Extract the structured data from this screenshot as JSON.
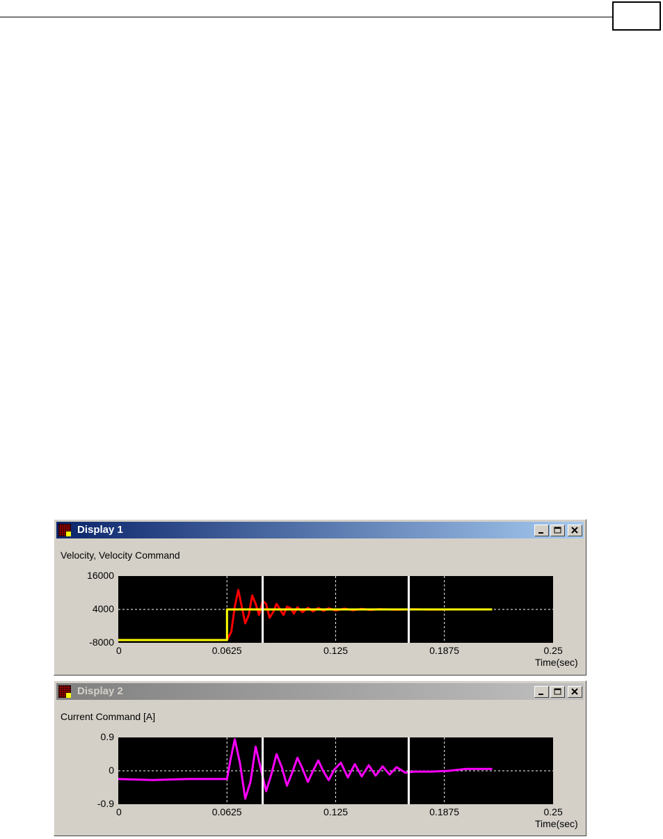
{
  "displays": [
    {
      "title": "Display 1",
      "active": true,
      "chart_data": {
        "type": "line",
        "title": "Velocity, Velocity Command",
        "xlabel": "Time(sec)",
        "x_ticks": [
          "0",
          "0.0625",
          "0.125",
          "0.1875",
          "0.25"
        ],
        "y_ticks": [
          "16000",
          "4000",
          "-8000"
        ],
        "xlim": [
          0,
          0.25
        ],
        "ylim": [
          -8000,
          16000
        ],
        "grid": true,
        "cursors_x": [
          0.083,
          0.167
        ],
        "series": [
          {
            "color": "#ff0000",
            "x": [
              0,
              0.062,
              0.0625,
              0.065,
              0.067,
              0.069,
              0.071,
              0.073,
              0.075,
              0.077,
              0.079,
              0.081,
              0.083,
              0.085,
              0.087,
              0.089,
              0.091,
              0.093,
              0.095,
              0.097,
              0.099,
              0.101,
              0.103,
              0.106,
              0.109,
              0.112,
              0.115,
              0.118,
              0.121,
              0.125,
              0.13,
              0.135,
              0.14,
              0.145,
              0.15,
              0.16,
              0.17,
              0.18,
              0.19,
              0.2,
              0.215
            ],
            "y": [
              -7000,
              -7000,
              -7000,
              -4000,
              5000,
              11000,
              5000,
              -1000,
              2000,
              9000,
              6000,
              2000,
              7000,
              6000,
              1000,
              3000,
              6000,
              4000,
              2000,
              5000,
              4500,
              2500,
              4800,
              3000,
              4600,
              3300,
              4500,
              3500,
              4400,
              3600,
              4300,
              3700,
              4200,
              3800,
              4100,
              3900,
              4050,
              3950,
              4000,
              4000,
              4000
            ]
          },
          {
            "color": "#ffff00",
            "x": [
              0,
              0.0625,
              0.0625,
              0.215
            ],
            "y": [
              -7000,
              -7000,
              4000,
              4000
            ]
          }
        ]
      }
    },
    {
      "title": "Display 2",
      "active": false,
      "chart_data": {
        "type": "line",
        "title": "Current Command [A]",
        "xlabel": "Time(sec)",
        "x_ticks": [
          "0",
          "0.0625",
          "0.125",
          "0.1875",
          "0.25"
        ],
        "y_ticks": [
          "0.9",
          "0",
          "-0.9"
        ],
        "xlim": [
          0,
          0.25
        ],
        "ylim": [
          -0.9,
          0.9
        ],
        "grid": true,
        "cursors_x": [
          0.083,
          0.167
        ],
        "series": [
          {
            "color": "#ff00ff",
            "x": [
              0,
              0.02,
              0.04,
              0.0625,
              0.0645,
              0.067,
              0.07,
              0.073,
              0.076,
              0.079,
              0.082,
              0.085,
              0.088,
              0.091,
              0.094,
              0.097,
              0.1,
              0.103,
              0.106,
              0.109,
              0.112,
              0.115,
              0.118,
              0.121,
              0.124,
              0.128,
              0.132,
              0.136,
              0.14,
              0.144,
              0.148,
              0.152,
              0.156,
              0.16,
              0.165,
              0.17,
              0.18,
              0.19,
              0.2,
              0.215
            ],
            "y": [
              -0.22,
              -0.25,
              -0.22,
              -0.22,
              0.3,
              0.85,
              0.2,
              -0.75,
              -0.3,
              0.65,
              0.05,
              -0.55,
              -0.1,
              0.45,
              0.1,
              -0.4,
              -0.05,
              0.35,
              0.05,
              -0.3,
              0.0,
              0.28,
              -0.02,
              -0.25,
              0.02,
              0.22,
              -0.18,
              0.18,
              -0.15,
              0.15,
              -0.13,
              0.12,
              -0.1,
              0.1,
              -0.05,
              -0.02,
              -0.02,
              0.0,
              0.05,
              0.05
            ]
          }
        ]
      }
    }
  ]
}
